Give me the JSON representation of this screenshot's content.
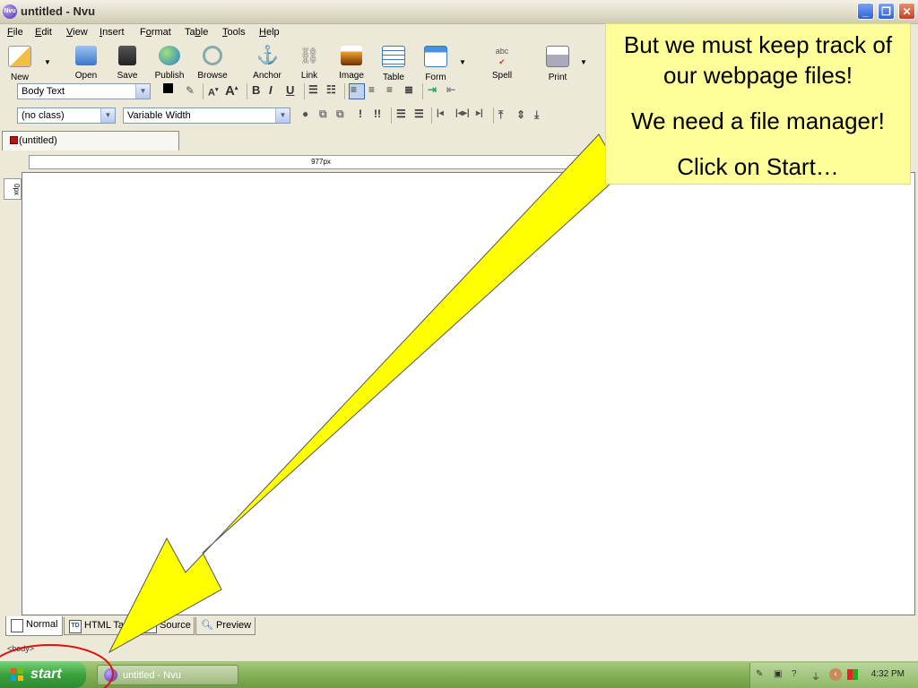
{
  "window": {
    "title": "untitled - Nvu",
    "app_icon": "Nvu"
  },
  "menu": [
    {
      "label": "File",
      "key": "F",
      "rest": "ile"
    },
    {
      "label": "Edit",
      "key": "E",
      "rest": "dit"
    },
    {
      "label": "View",
      "key": "V",
      "rest": "iew"
    },
    {
      "label": "Insert",
      "key": "I",
      "rest": "nsert"
    },
    {
      "label": "Format",
      "key": "o",
      "pre": "F",
      "rest": "rmat"
    },
    {
      "label": "Table",
      "key": "b",
      "pre": "Ta",
      "rest": "le"
    },
    {
      "label": "Tools",
      "key": "T",
      "rest": "ools"
    },
    {
      "label": "Help",
      "key": "H",
      "rest": "elp"
    }
  ],
  "toolbar": {
    "new": "New",
    "open": "Open",
    "save": "Save",
    "publish": "Publish",
    "browse": "Browse",
    "anchor": "Anchor",
    "link": "Link",
    "image": "Image",
    "table": "Table",
    "form": "Form",
    "spell": "Spell",
    "print": "Print"
  },
  "format": {
    "paragraph_style": "Body Text",
    "class": "(no class)",
    "font": "Variable Width",
    "bold": "B",
    "italic": "I",
    "underline": "U",
    "emphasis_one": "!",
    "emphasis_two": "!!"
  },
  "tabs": {
    "document": "(untitled)"
  },
  "ruler": {
    "width_label": "977px",
    "vertical_label": "0px"
  },
  "view_tabs": {
    "normal": "Normal",
    "html_tags": "HTML Tags",
    "source": "Source",
    "preview": "Preview",
    "html_tags_icon": "TD"
  },
  "status": {
    "path": "<body>"
  },
  "taskbar": {
    "start": "start",
    "task": "untitled - Nvu",
    "clock": "4:32 PM"
  },
  "callout": {
    "line1": "But we must keep track of our webpage files!",
    "line2": "We need a file manager!",
    "line3": "Click on Start…"
  },
  "colors": {
    "callout_bg": "#ffff99",
    "arrow": "#ffff00",
    "circle": "#e01010"
  }
}
